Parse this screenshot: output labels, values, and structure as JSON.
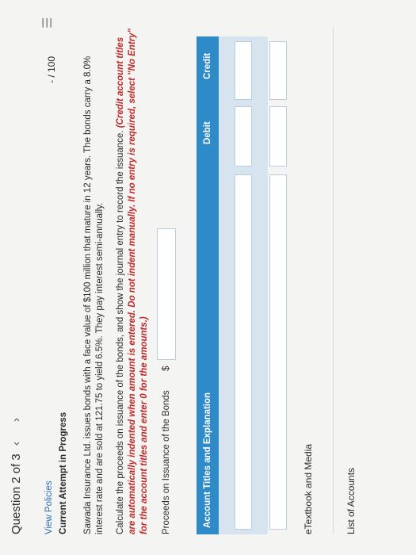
{
  "header": {
    "question_label": "Question 2 of 3",
    "prev_icon": "chevron-left-icon",
    "next_icon": "chevron-right-icon",
    "score": "- / 100",
    "menu_icon": "menu-icon"
  },
  "links": {
    "view_policies": "View Policies"
  },
  "status": {
    "current_attempt": "Current Attempt in Progress"
  },
  "problem": {
    "intro": "Sawada Insurance Ltd. issues bonds with a face value of $100 million that mature in 12 years. The bonds carry a 8.0% interest rate and are sold at 121.75 to yield 6.5%. They pay interest semi-annually.",
    "instruction_plain": "Calculate the proceeds on issuance of the bonds, and show the journal entry to record the issuance.",
    "instruction_red": "(Credit account titles are automatically indented when amount is entered. Do not indent manually. If no entry is required, select \"No Entry\" for the account titles and enter 0 for the amounts.)"
  },
  "proceeds": {
    "label": "Proceeds on Issuance of the Bonds",
    "currency": "$",
    "value": ""
  },
  "journal_table": {
    "headers": [
      "Account Titles and Explanation",
      "Debit",
      "Credit"
    ],
    "rows": [
      {
        "account": "",
        "debit": "",
        "credit": ""
      },
      {
        "account": "",
        "debit": "",
        "credit": ""
      }
    ]
  },
  "footer": {
    "etextbook": "eTextbook and Media",
    "list_of_accounts": "List of Accounts"
  },
  "colors": {
    "accent": "#2e8bc8",
    "link": "#2a6fb5",
    "warning": "#c0292a",
    "row_bg": "#d6e4f0"
  }
}
